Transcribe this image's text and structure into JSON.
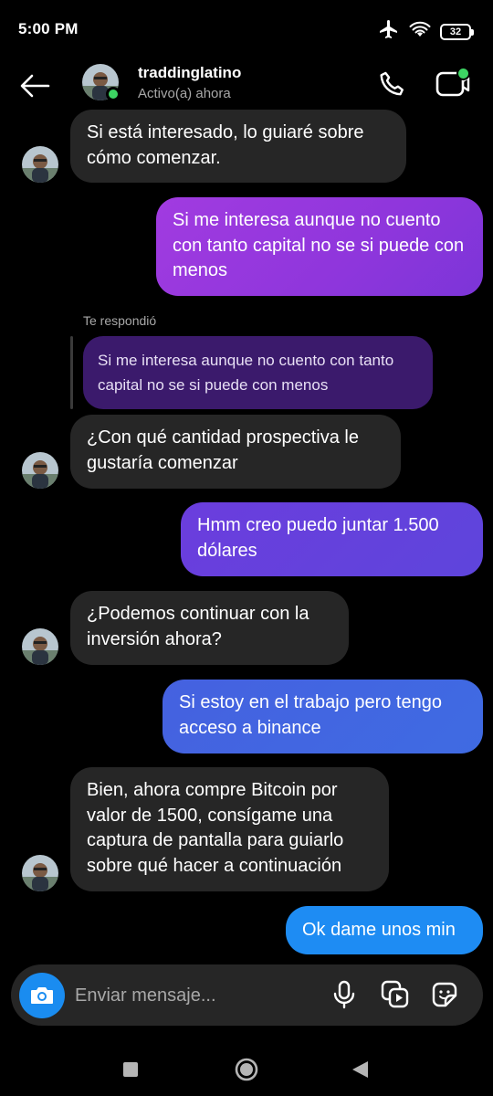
{
  "status_bar": {
    "time": "5:00 PM",
    "battery": "32",
    "icons": [
      "airplane-icon",
      "wifi-icon",
      "battery-icon"
    ]
  },
  "header": {
    "username": "traddinglatino",
    "activity": "Activo(a) ahora"
  },
  "colors": {
    "background": "#000000",
    "incoming": "#262626",
    "online": "#3dd463",
    "camera": "#1a8cf0"
  },
  "messages": [
    {
      "from": "them",
      "text": "Si está interesado, lo guiaré sobre cómo comenzar."
    },
    {
      "from": "me",
      "text": "Si me interesa aunque no cuento con tanto capital no se si puede con menos"
    },
    {
      "from": "them",
      "reply_label": "Te respondió",
      "quoted": "Si me interesa aunque no cuento con tanto capital no se si puede con menos",
      "text": "¿Con qué cantidad prospectiva le gustaría comenzar"
    },
    {
      "from": "me",
      "text": "Hmm creo puedo juntar 1.500 dólares"
    },
    {
      "from": "them",
      "text": "¿Podemos continuar con la inversión ahora?"
    },
    {
      "from": "me",
      "text": "Si estoy en el trabajo pero tengo acceso a binance"
    },
    {
      "from": "them",
      "text": "Bien, ahora compre Bitcoin por valor de 1500, consígame una captura de pantalla para guiarlo sobre qué hacer a continuación"
    },
    {
      "from": "me",
      "text": "Ok dame unos min"
    }
  ],
  "composer": {
    "placeholder": "Enviar mensaje...",
    "icons": [
      "camera-icon",
      "microphone-icon",
      "gallery-icon",
      "sticker-icon"
    ]
  },
  "nav": {
    "icons": [
      "recents-icon",
      "home-icon",
      "back-icon"
    ]
  }
}
